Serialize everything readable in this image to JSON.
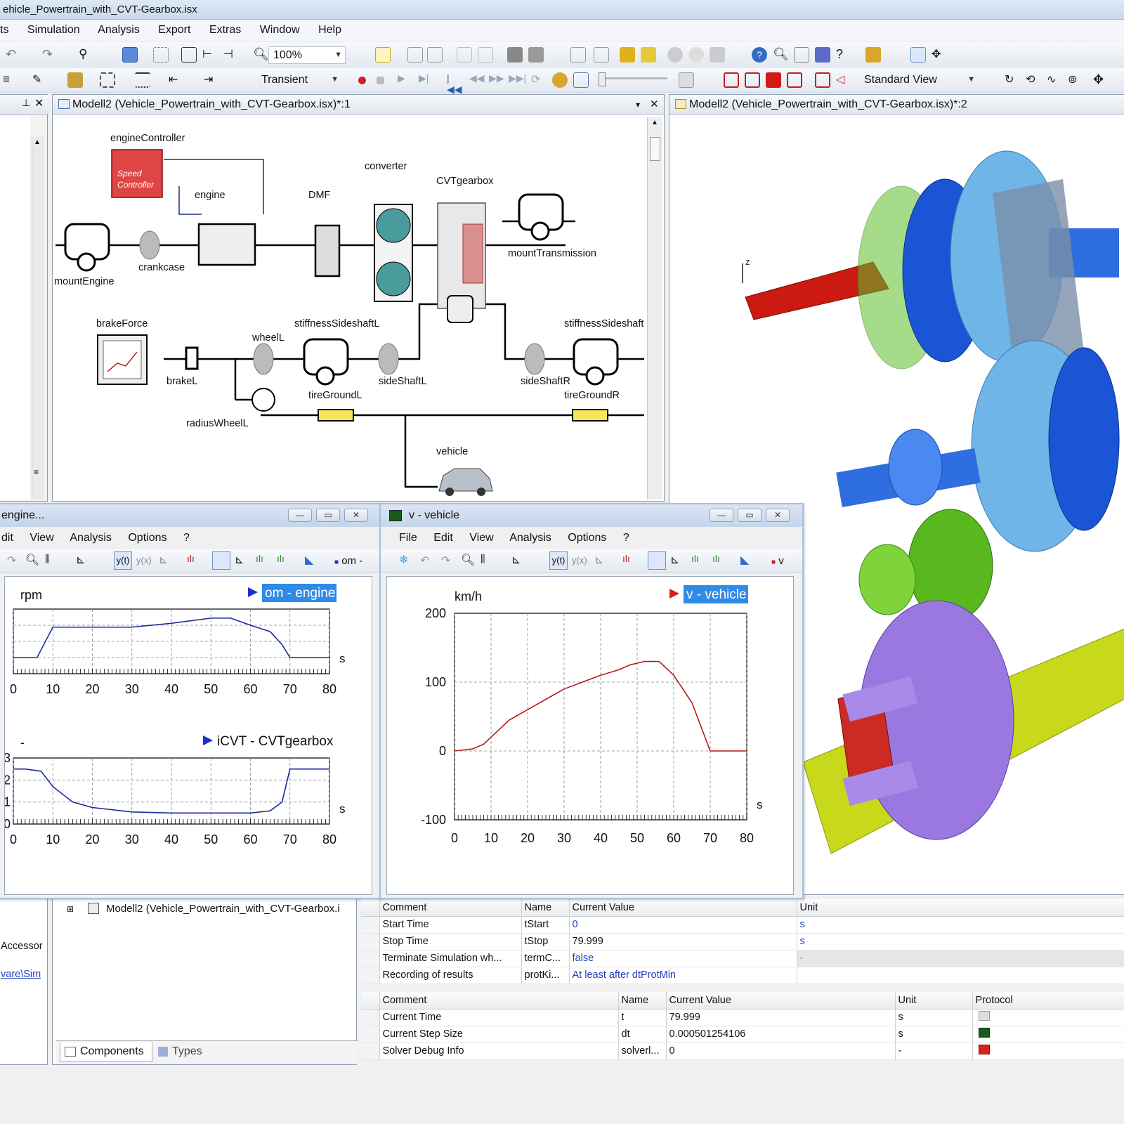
{
  "window": {
    "title": "ehicle_Powertrain_with_CVT-Gearbox.isx"
  },
  "menu": [
    "ts",
    "Simulation",
    "Analysis",
    "Export",
    "Extras",
    "Window",
    "Help"
  ],
  "toolbar": {
    "zoom": "100%",
    "mode": "Transient",
    "view": "Standard View"
  },
  "tabs": {
    "diagram": "Modell2 (Vehicle_Powertrain_with_CVT-Gearbox.isx)*:1",
    "view3d": "Modell2 (Vehicle_Powertrain_with_CVT-Gearbox.isx)*:2"
  },
  "diagram": {
    "labels": {
      "engineController": "engineController",
      "speed_controller_line1": "Speed",
      "speed_controller_line2": "Controller",
      "engine": "engine",
      "dmf": "DMF",
      "converter": "converter",
      "cvtgearbox": "CVTgearbox",
      "mountTransmission": "mountTransmission",
      "mountEngine": "mountEngine",
      "crankcase": "crankcase",
      "brakeForce": "brakeForce",
      "wheelL": "wheelL",
      "stiffnessSideshaftL": "stiffnessSideshaftL",
      "stiffnessSideshaft": "stiffnessSideshaft",
      "brakeL": "brakeL",
      "tireGroundL": "tireGroundL",
      "sideShaftL": "sideShaftL",
      "sideShaftR": "sideShaftR",
      "tireGroundR": "tireGroundR",
      "radiusWheelL": "radiusWheelL",
      "vehicle": "vehicle"
    }
  },
  "view3d": {
    "axis_label": "z",
    "colors": {
      "red": "#cc1a12",
      "blue": "#1a55d6",
      "lightblue": "#6fb5e8",
      "green": "#5fc02a",
      "purple": "#9a78e0",
      "yellow": "#c8d81a"
    }
  },
  "plot_left": {
    "title": "engine...",
    "menu": [
      "dit",
      "View",
      "Analysis",
      "Options",
      "?"
    ],
    "toolbar_trailing": "om -",
    "top": {
      "unit": "rpm",
      "legend": "om - engine",
      "xunit": "s"
    },
    "bottom": {
      "unit": "-",
      "legend": "iCVT - CVTgearbox",
      "xunit": "s"
    }
  },
  "plot_right": {
    "title": "v - vehicle",
    "menu": [
      "File",
      "Edit",
      "View",
      "Analysis",
      "Options",
      "?"
    ],
    "toolbar_trailing": "v",
    "unit": "km/h",
    "legend": "v - vehicle",
    "xunit": "s"
  },
  "chart_data": [
    {
      "type": "line",
      "title": "",
      "ylabel": "rpm",
      "xlabel": "s",
      "series": [
        {
          "name": "om - engine",
          "x": [
            0,
            6,
            10,
            20,
            30,
            40,
            50,
            55,
            60,
            65,
            68,
            70,
            80
          ],
          "y": [
            0.25,
            0.25,
            0.72,
            0.72,
            0.72,
            0.78,
            0.86,
            0.86,
            0.75,
            0.65,
            0.45,
            0.25,
            0.25
          ]
        }
      ],
      "xticks": [
        "0",
        "10",
        "20",
        "30",
        "40",
        "50",
        "60",
        "70",
        "80"
      ],
      "xlim": [
        0,
        80
      ],
      "grid": true,
      "note_y": "y tick labels clipped in screenshot; values normalized to plot height"
    },
    {
      "type": "line",
      "title": "",
      "ylabel": "-",
      "xlabel": "s",
      "series": [
        {
          "name": "iCVT - CVTgearbox",
          "x": [
            0,
            3,
            7,
            10,
            15,
            20,
            30,
            40,
            50,
            60,
            65,
            68,
            70,
            80
          ],
          "y": [
            2.5,
            2.5,
            2.4,
            1.7,
            1.0,
            0.75,
            0.55,
            0.5,
            0.5,
            0.5,
            0.6,
            1.0,
            2.5,
            2.5
          ]
        }
      ],
      "yticks": [
        "0",
        "1",
        "2",
        "3"
      ],
      "ylim": [
        0,
        3
      ],
      "xticks": [
        "0",
        "10",
        "20",
        "30",
        "40",
        "50",
        "60",
        "70",
        "80"
      ],
      "xlim": [
        0,
        80
      ],
      "grid": true
    },
    {
      "type": "line",
      "title": "",
      "ylabel": "km/h",
      "xlabel": "s",
      "series": [
        {
          "name": "v - vehicle",
          "x": [
            0,
            5,
            8,
            12,
            15,
            20,
            25,
            30,
            35,
            40,
            45,
            48,
            52,
            56,
            60,
            65,
            70,
            80
          ],
          "y": [
            0,
            3,
            10,
            30,
            45,
            60,
            75,
            90,
            100,
            110,
            118,
            125,
            130,
            130,
            110,
            70,
            0,
            0
          ]
        }
      ],
      "yticks": [
        "200",
        "100",
        "0",
        "-100"
      ],
      "ylim": [
        -100,
        200
      ],
      "xticks": [
        "0",
        "10",
        "20",
        "30",
        "40",
        "50",
        "60",
        "70",
        "80"
      ],
      "xlim": [
        0,
        80
      ],
      "grid": true
    }
  ],
  "bottom_left": {
    "tree_item": "Modell2 (Vehicle_Powertrain_with_CVT-Gearbox.i",
    "side1": "Accessor",
    "side2": "vare\\Sim",
    "tab_components": "Components",
    "tab_types": "Types"
  },
  "params_table": {
    "headers": [
      "Comment",
      "Name",
      "Current Value",
      "Unit"
    ],
    "rows": [
      [
        "Start Time",
        "tStart",
        "0",
        "s"
      ],
      [
        "Stop Time",
        "tStop",
        "79.999",
        "s"
      ],
      [
        "Terminate Simulation wh...",
        "termC...",
        "false",
        "-"
      ],
      [
        "Recording of results",
        "protKi...",
        "At least after dtProtMin",
        ""
      ]
    ]
  },
  "state_table": {
    "headers": [
      "Comment",
      "Name",
      "Current Value",
      "Unit",
      "Protocol"
    ],
    "rows": [
      [
        "Current Time",
        "t",
        "79.999",
        "s",
        ""
      ],
      [
        "Current Step Size",
        "dt",
        "0.000501254106",
        "s",
        ""
      ],
      [
        "Solver Debug Info",
        "solverl...",
        "0",
        "-",
        ""
      ]
    ]
  }
}
